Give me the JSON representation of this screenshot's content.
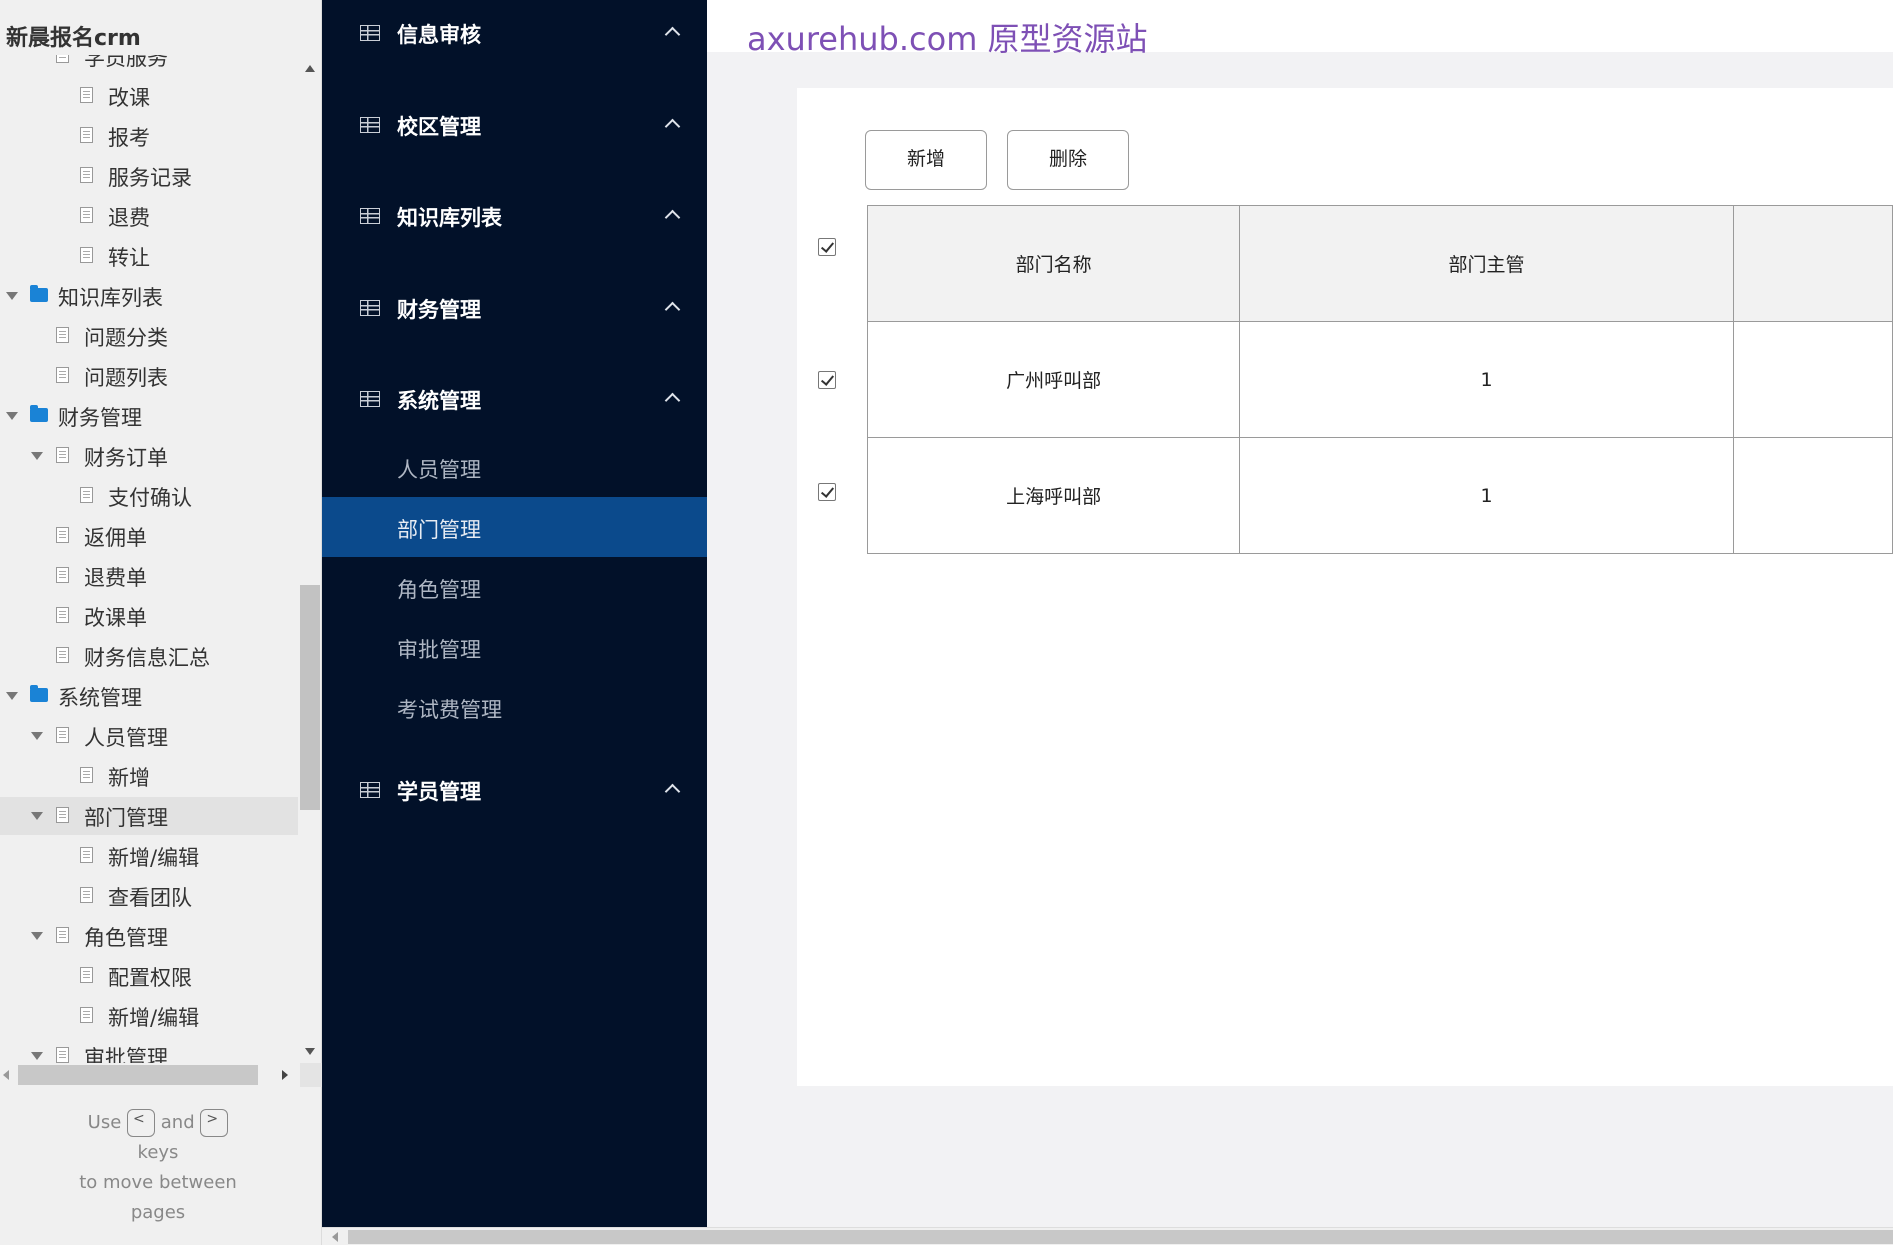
{
  "tree": {
    "title": "新晨报名crm",
    "partial_top_label": "学员服务",
    "items": [
      {
        "label": "改课",
        "kind": "page"
      },
      {
        "label": "报考",
        "kind": "page"
      },
      {
        "label": "服务记录",
        "kind": "page"
      },
      {
        "label": "退费",
        "kind": "page"
      },
      {
        "label": "转让",
        "kind": "page"
      },
      {
        "label": "知识库列表",
        "kind": "folder"
      },
      {
        "label": "问题分类",
        "kind": "page"
      },
      {
        "label": "问题列表",
        "kind": "page"
      },
      {
        "label": "财务管理",
        "kind": "folder"
      },
      {
        "label": "财务订单",
        "kind": "page"
      },
      {
        "label": "支付确认",
        "kind": "page"
      },
      {
        "label": "返佣单",
        "kind": "page"
      },
      {
        "label": "退费单",
        "kind": "page"
      },
      {
        "label": "改课单",
        "kind": "page"
      },
      {
        "label": "财务信息汇总",
        "kind": "page"
      },
      {
        "label": "系统管理",
        "kind": "folder"
      },
      {
        "label": "人员管理",
        "kind": "page"
      },
      {
        "label": "新增",
        "kind": "page"
      },
      {
        "label": "部门管理",
        "kind": "page",
        "selected": true
      },
      {
        "label": "新增/编辑",
        "kind": "page"
      },
      {
        "label": "查看团队",
        "kind": "page"
      },
      {
        "label": "角色管理",
        "kind": "page"
      },
      {
        "label": "配置权限",
        "kind": "page"
      },
      {
        "label": "新增/编辑",
        "kind": "page"
      }
    ],
    "partial_bottom_label": "审批管理",
    "hint": {
      "use": "Use",
      "and": "and",
      "keys": "keys",
      "line2": "to move between",
      "line3": "pages",
      "key_prev": "<",
      "key_next": ">"
    }
  },
  "nav": {
    "groups": [
      {
        "label": "信息审核"
      },
      {
        "label": "校区管理"
      },
      {
        "label": "知识库列表"
      },
      {
        "label": "财务管理"
      },
      {
        "label": "系统管理"
      }
    ],
    "sub_items": [
      {
        "label": "人员管理"
      },
      {
        "label": "部门管理",
        "active": true
      },
      {
        "label": "角色管理"
      },
      {
        "label": "审批管理"
      },
      {
        "label": "考试费管理"
      }
    ],
    "last_group": {
      "label": "学员管理"
    },
    "colors": {
      "background": "#021129",
      "active": "#0b4a8c"
    }
  },
  "main": {
    "watermark": "axurehub.com 原型资源站",
    "buttons": {
      "add": "新增",
      "delete": "删除"
    },
    "table": {
      "headers": [
        "部门名称",
        "部门主管",
        ""
      ],
      "rows": [
        {
          "name": "广州呼叫部",
          "manager": "1",
          "extra": ""
        },
        {
          "name": "上海呼叫部",
          "manager": "1",
          "extra": ""
        }
      ],
      "all_checked": true
    }
  }
}
